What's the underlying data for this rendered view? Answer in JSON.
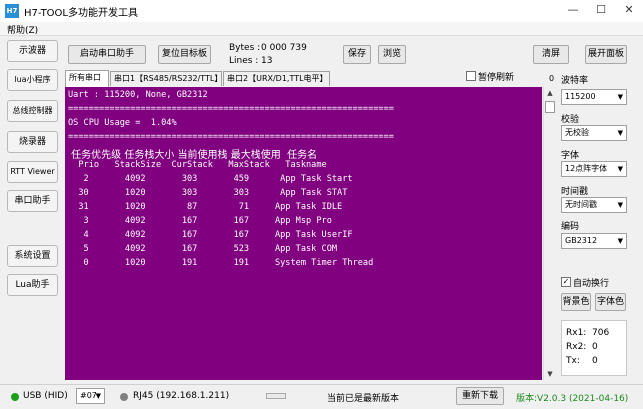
{
  "app": {
    "icon_text": "H7",
    "title": "H7-TOOL多功能开发工具"
  },
  "window_controls": {
    "minimize": "—",
    "maximize": "☐",
    "close": "✕"
  },
  "menu": {
    "help": "帮助(Z)"
  },
  "sidebar": {
    "items": [
      {
        "label": "示波器"
      },
      {
        "label": "lua小程序"
      },
      {
        "label": "总线控制器"
      },
      {
        "label": "烧录器"
      },
      {
        "label": "RTT Viewer"
      },
      {
        "label": "串口助手"
      },
      {
        "label": "系统设置"
      },
      {
        "label": "Lua助手"
      }
    ]
  },
  "toolbar": {
    "start_serial": "启动串口助手",
    "reset_target": "复位目标板",
    "bytes_label": "Bytes :",
    "bytes_value": "0 000 739",
    "lines_label": "Lines :",
    "lines_value": "13",
    "save": "保存",
    "browse": "浏览",
    "clear": "清屏",
    "expand_panel": "展开面板"
  },
  "tabs": [
    {
      "label": "所有串口"
    },
    {
      "label": "串口1【RS485/RS232/TTL】"
    },
    {
      "label": "串口2【URX/D1,TTL电平】"
    }
  ],
  "pause_refresh": {
    "label": "暂停刷新",
    "checked": false
  },
  "scroll_value": "0",
  "terminal": {
    "lines": [
      "Uart : 115200, None, GB2312",
      "===============================================================",
      "OS CPU Usage =  1.04%",
      "===============================================================",
      " 任务优先级 任务栈大小 当前使用栈 最大栈使用  任务名",
      "  Prio   StackSize  CurStack   MaxStack   Taskname",
      "   2       4092       303       459      App Task Start",
      "  30       1020       303       303      App Task STAT",
      "  31       1020        87        71     App Task IDLE",
      "   3       4092       167       167     App Msp Pro",
      "   4       4092       167       167     App Task UserIF",
      "   5       4092       167       523     App Task COM",
      "   0       1020       191       191     System Timer Thread"
    ]
  },
  "settings": {
    "baud_label": "波特率",
    "baud_value": "115200",
    "parity_label": "校验",
    "parity_value": "无校验",
    "font_label": "字体",
    "font_value": "12点阵字体",
    "timestamp_label": "时间戳",
    "timestamp_value": "无时间戳",
    "encoding_label": "编码",
    "encoding_value": "GB2312",
    "auto_wrap_label": "自动换行",
    "auto_wrap_checked": true,
    "bg_color_button": "背景色",
    "font_color_button": "字体色",
    "rx1_label": "Rx1:",
    "rx1_value": "706",
    "rx2_label": "Rx2:",
    "rx2_value": "0",
    "tx_label": "Tx:",
    "tx_value": "0"
  },
  "statusbar": {
    "usb_label": "USB (HID)",
    "usb_color": "#1aa01a",
    "device_value": "#07",
    "rj45_label": "RJ45 (192.168.1.211)",
    "rj45_color": "#808080",
    "status_text": "当前已是最新版本",
    "redownload": "重新下载",
    "version": "版本:V2.0.3 (2021-04-16)",
    "version_color": "#1a8a1a"
  },
  "colors": {
    "terminal_bg": "#800080",
    "terminal_fg": "#ffffff",
    "accent": "#2b8fd6"
  },
  "icons": {
    "app": "h7-app-icon",
    "dropdown": "chevron-down-icon",
    "check": "check-icon"
  }
}
